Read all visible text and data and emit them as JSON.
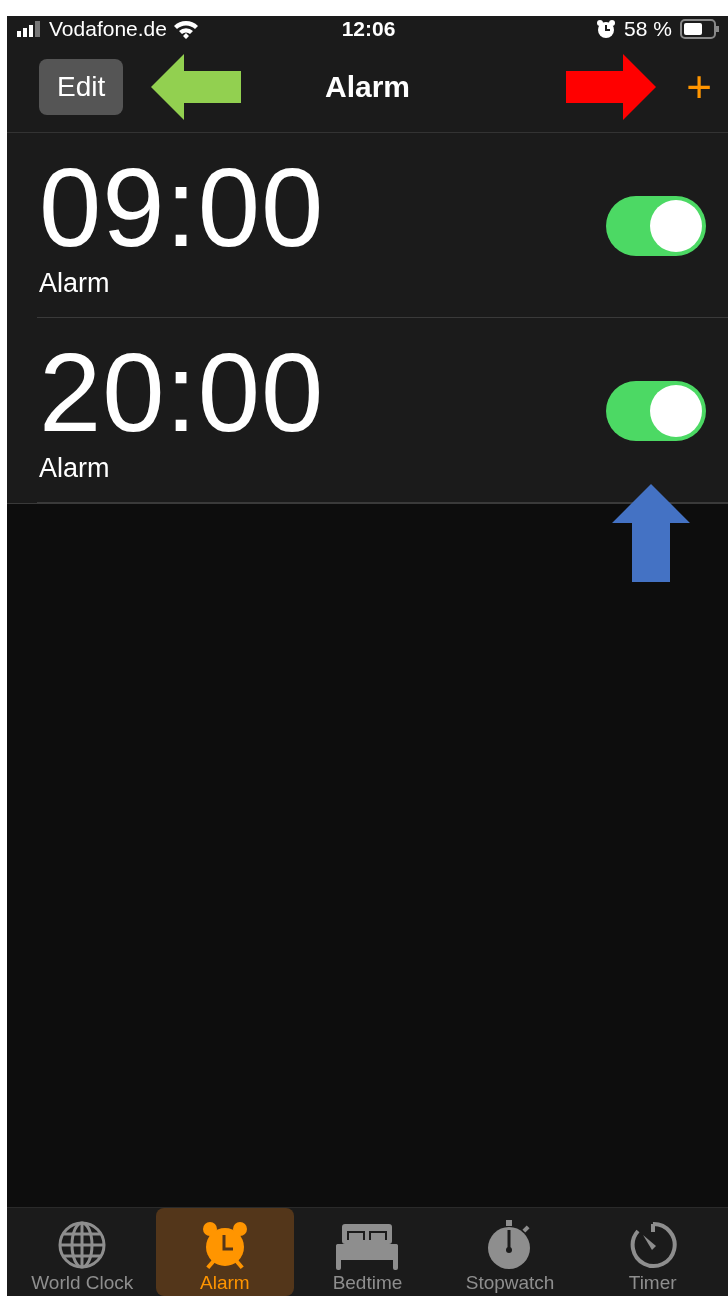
{
  "status_bar": {
    "carrier": "Vodafone.de",
    "time": "12:06",
    "battery": "58 %"
  },
  "nav": {
    "edit": "Edit",
    "title": "Alarm",
    "add": "+"
  },
  "alarms": [
    {
      "time": "09:00",
      "label": "Alarm",
      "on": true
    },
    {
      "time": "20:00",
      "label": "Alarm",
      "on": true
    }
  ],
  "tabs": [
    {
      "label": "World Clock",
      "selected": false
    },
    {
      "label": "Alarm",
      "selected": true
    },
    {
      "label": "Bedtime",
      "selected": false
    },
    {
      "label": "Stopwatch",
      "selected": false
    },
    {
      "label": "Timer",
      "selected": false
    }
  ]
}
